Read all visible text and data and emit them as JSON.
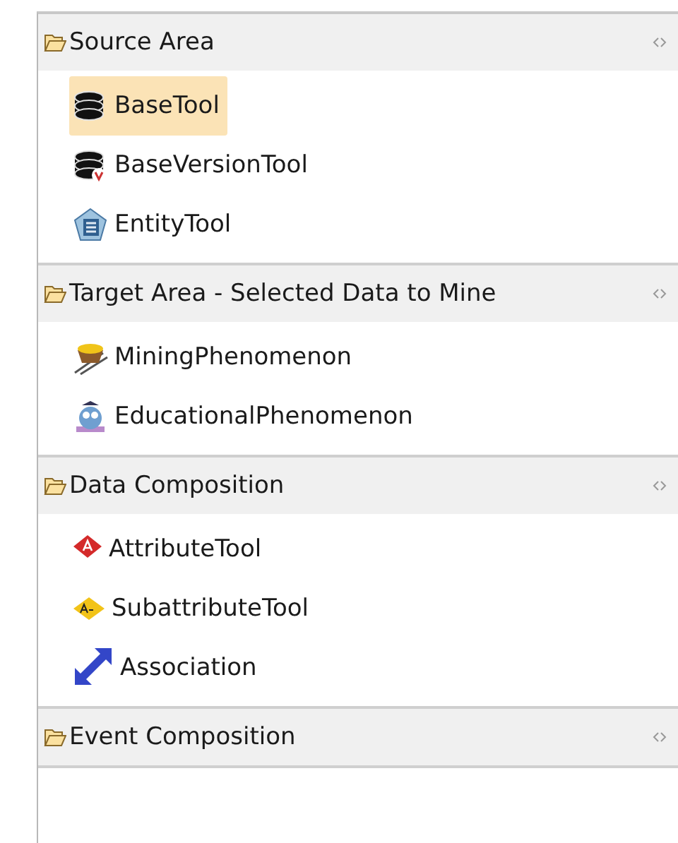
{
  "palette": {
    "sections": [
      {
        "title": "Source Area",
        "expanded": true,
        "items": [
          {
            "label": "BaseTool",
            "kind": "database",
            "selected": true
          },
          {
            "label": "BaseVersionTool",
            "kind": "database-version",
            "selected": false
          },
          {
            "label": "EntityTool",
            "kind": "entity",
            "selected": false
          }
        ]
      },
      {
        "title": "Target Area - Selected Data to Mine",
        "expanded": true,
        "items": [
          {
            "label": "MiningPhenomenon",
            "kind": "mine-cart",
            "selected": false
          },
          {
            "label": "EducationalPhenomenon",
            "kind": "owl",
            "selected": false
          }
        ]
      },
      {
        "title": "Data Composition",
        "expanded": true,
        "items": [
          {
            "label": "AttributeTool",
            "kind": "attribute",
            "selected": false
          },
          {
            "label": "SubattributeTool",
            "kind": "subattribute",
            "selected": false
          },
          {
            "label": "Association",
            "kind": "association",
            "selected": false
          }
        ]
      },
      {
        "title": "Event Composition",
        "expanded": true
      }
    ]
  }
}
